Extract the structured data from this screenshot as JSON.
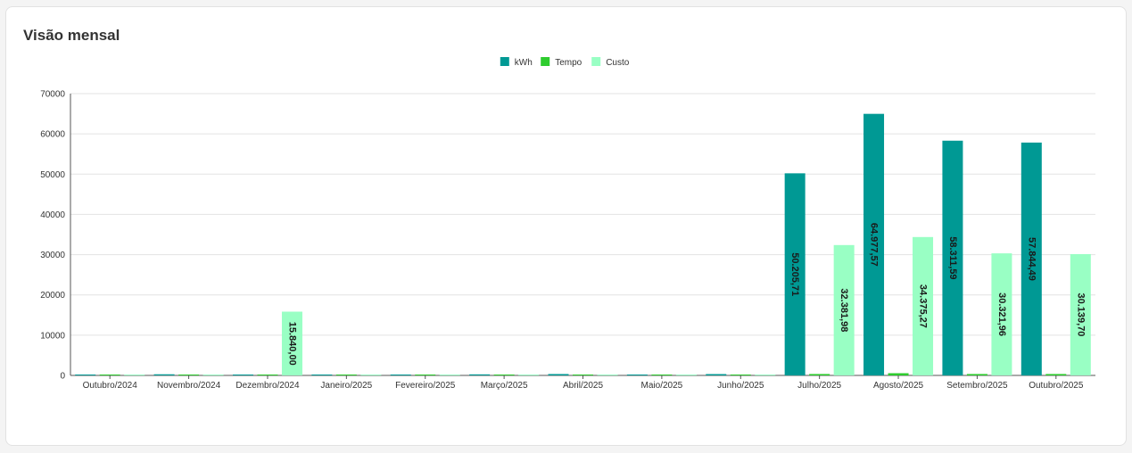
{
  "card": {
    "title": "Visão mensal"
  },
  "chart_data": {
    "type": "bar",
    "title": "",
    "xlabel": "",
    "ylabel": "",
    "ylim": [
      0,
      70000
    ],
    "yticks": [
      0,
      10000,
      20000,
      30000,
      40000,
      50000,
      60000,
      70000
    ],
    "grid": true,
    "legend": "top-center",
    "categories": [
      "Outubro/2024",
      "Novembro/2024",
      "Dezembro/2024",
      "Janeiro/2025",
      "Fevereiro/2025",
      "Março/2025",
      "Abril/2025",
      "Maio/2025",
      "Junho/2025",
      "Julho/2025",
      "Agosto/2025",
      "Setembro/2025",
      "Outubro/2025"
    ],
    "series": [
      {
        "name": "kWh",
        "color": "#009994",
        "values": [
          120,
          280,
          120,
          120,
          120,
          260,
          340,
          120,
          330,
          50205.71,
          64977.57,
          58311.59,
          57844.49
        ],
        "labels": [
          "",
          "",
          "",
          "",
          "",
          "",
          "",
          "",
          "",
          "50.205,71",
          "64.977,57",
          "58.311,59",
          "57.844,49"
        ]
      },
      {
        "name": "Tempo",
        "color": "#2ecc2e",
        "values": [
          60,
          100,
          60,
          60,
          60,
          60,
          120,
          60,
          120,
          350,
          550,
          350,
          350
        ],
        "labels": [
          "",
          "",
          "",
          "",
          "",
          "",
          "",
          "",
          "",
          "",
          "",
          "",
          ""
        ]
      },
      {
        "name": "Custo",
        "color": "#99ffc4",
        "values": [
          60,
          120,
          15840.0,
          60,
          60,
          60,
          140,
          60,
          140,
          32381.98,
          34375.27,
          30321.96,
          30139.7
        ],
        "labels": [
          "",
          "",
          "15.840,00",
          "",
          "",
          "",
          "",
          "",
          "",
          "32.381,98",
          "34.375,27",
          "30.321,96",
          "30.139,70"
        ]
      }
    ]
  }
}
